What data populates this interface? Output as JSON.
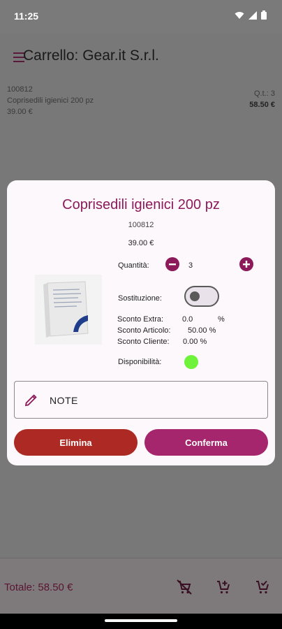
{
  "status": {
    "time": "11:25"
  },
  "appbar": {
    "title": "Carrello: Gear.it S.r.l."
  },
  "cart_item": {
    "code": "100812",
    "name": "Coprisedili igienici 200 pz",
    "price": "39.00 €",
    "qty": "Q.t.: 3",
    "total": "58.50 €"
  },
  "dialog": {
    "title": "Coprisedili igienici 200 pz",
    "code": "100812",
    "price": "39.00 €",
    "quantity_label": "Quantità:",
    "quantity_value": "3",
    "substitution_label": "Sostituzione:",
    "substitution_on": false,
    "discounts": [
      {
        "label": "Sconto Extra:",
        "value": "0.0",
        "unit": "%"
      },
      {
        "label": "Sconto Articolo:",
        "value": "50.00 %",
        "unit": ""
      },
      {
        "label": "Sconto Cliente:",
        "value": "0.00 %",
        "unit": ""
      }
    ],
    "availability_label": "Disponibilità:",
    "availability_color": "#6ef23a",
    "note_label": "NOTE",
    "delete_label": "Elimina",
    "confirm_label": "Conferma"
  },
  "footer": {
    "total": "Totale: 58.50 €"
  },
  "colors": {
    "primary": "#8c1a5a",
    "delete": "#ad2a24",
    "confirm": "#a5266c"
  },
  "icons": {
    "bottom": [
      "cart-remove-icon",
      "cart-add-icon",
      "cart-check-icon"
    ]
  }
}
